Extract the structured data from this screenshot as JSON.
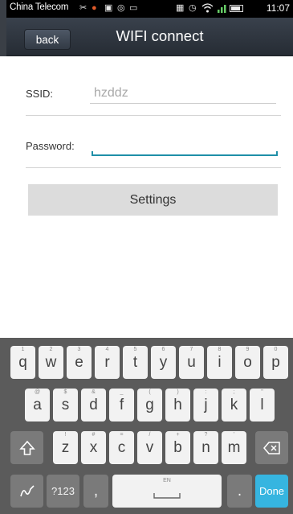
{
  "status_bar": {
    "carrier": "China Telecom",
    "time": "11:07",
    "icons": [
      "notification-icons",
      "wifi-icon",
      "signal-icon",
      "battery-icon"
    ]
  },
  "header": {
    "back_label": "back",
    "title": "WIFI connect"
  },
  "form": {
    "ssid_label": "SSID:",
    "ssid_value": "hzddz",
    "password_label": "Password:",
    "password_value": "",
    "settings_label": "Settings"
  },
  "keyboard": {
    "row1": [
      {
        "key": "q",
        "hint": "1"
      },
      {
        "key": "w",
        "hint": "2"
      },
      {
        "key": "e",
        "hint": "3"
      },
      {
        "key": "r",
        "hint": "4"
      },
      {
        "key": "t",
        "hint": "5"
      },
      {
        "key": "y",
        "hint": "6"
      },
      {
        "key": "u",
        "hint": "7"
      },
      {
        "key": "i",
        "hint": "8"
      },
      {
        "key": "o",
        "hint": "9"
      },
      {
        "key": "p",
        "hint": "0"
      }
    ],
    "row2": [
      {
        "key": "a",
        "hint": "@"
      },
      {
        "key": "s",
        "hint": "$"
      },
      {
        "key": "d",
        "hint": "&"
      },
      {
        "key": "f",
        "hint": "_"
      },
      {
        "key": "g",
        "hint": "("
      },
      {
        "key": "h",
        "hint": ")"
      },
      {
        "key": "j",
        "hint": ":"
      },
      {
        "key": "k",
        "hint": ";"
      },
      {
        "key": "l",
        "hint": "\""
      }
    ],
    "row3": [
      {
        "key": "z",
        "hint": "!"
      },
      {
        "key": "x",
        "hint": "#"
      },
      {
        "key": "c",
        "hint": "="
      },
      {
        "key": "v",
        "hint": "/"
      },
      {
        "key": "b",
        "hint": "+"
      },
      {
        "key": "n",
        "hint": "?"
      },
      {
        "key": "m",
        "hint": "'"
      }
    ],
    "symbols_label": "?123",
    "comma": ",",
    "space_hint": "EN",
    "period": ".",
    "done_label": "Done",
    "accent_color": "#36b5e0"
  }
}
